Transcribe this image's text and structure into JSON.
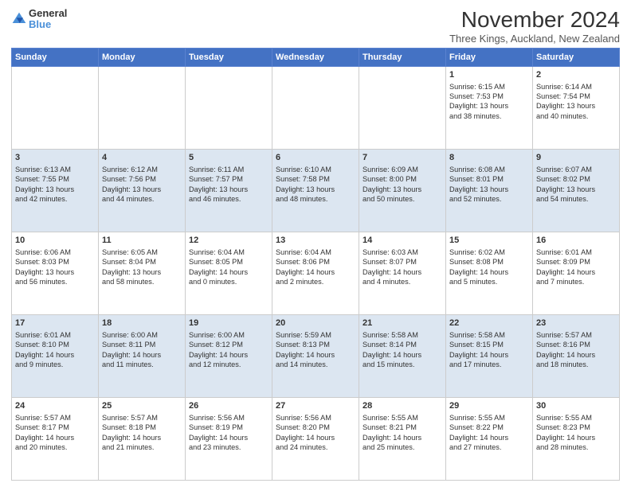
{
  "logo": {
    "general": "General",
    "blue": "Blue"
  },
  "title": "November 2024",
  "location": "Three Kings, Auckland, New Zealand",
  "days_header": [
    "Sunday",
    "Monday",
    "Tuesday",
    "Wednesday",
    "Thursday",
    "Friday",
    "Saturday"
  ],
  "weeks": [
    [
      {
        "day": "",
        "info": ""
      },
      {
        "day": "",
        "info": ""
      },
      {
        "day": "",
        "info": ""
      },
      {
        "day": "",
        "info": ""
      },
      {
        "day": "",
        "info": ""
      },
      {
        "day": "1",
        "info": "Sunrise: 6:15 AM\nSunset: 7:53 PM\nDaylight: 13 hours\nand 38 minutes."
      },
      {
        "day": "2",
        "info": "Sunrise: 6:14 AM\nSunset: 7:54 PM\nDaylight: 13 hours\nand 40 minutes."
      }
    ],
    [
      {
        "day": "3",
        "info": "Sunrise: 6:13 AM\nSunset: 7:55 PM\nDaylight: 13 hours\nand 42 minutes."
      },
      {
        "day": "4",
        "info": "Sunrise: 6:12 AM\nSunset: 7:56 PM\nDaylight: 13 hours\nand 44 minutes."
      },
      {
        "day": "5",
        "info": "Sunrise: 6:11 AM\nSunset: 7:57 PM\nDaylight: 13 hours\nand 46 minutes."
      },
      {
        "day": "6",
        "info": "Sunrise: 6:10 AM\nSunset: 7:58 PM\nDaylight: 13 hours\nand 48 minutes."
      },
      {
        "day": "7",
        "info": "Sunrise: 6:09 AM\nSunset: 8:00 PM\nDaylight: 13 hours\nand 50 minutes."
      },
      {
        "day": "8",
        "info": "Sunrise: 6:08 AM\nSunset: 8:01 PM\nDaylight: 13 hours\nand 52 minutes."
      },
      {
        "day": "9",
        "info": "Sunrise: 6:07 AM\nSunset: 8:02 PM\nDaylight: 13 hours\nand 54 minutes."
      }
    ],
    [
      {
        "day": "10",
        "info": "Sunrise: 6:06 AM\nSunset: 8:03 PM\nDaylight: 13 hours\nand 56 minutes."
      },
      {
        "day": "11",
        "info": "Sunrise: 6:05 AM\nSunset: 8:04 PM\nDaylight: 13 hours\nand 58 minutes."
      },
      {
        "day": "12",
        "info": "Sunrise: 6:04 AM\nSunset: 8:05 PM\nDaylight: 14 hours\nand 0 minutes."
      },
      {
        "day": "13",
        "info": "Sunrise: 6:04 AM\nSunset: 8:06 PM\nDaylight: 14 hours\nand 2 minutes."
      },
      {
        "day": "14",
        "info": "Sunrise: 6:03 AM\nSunset: 8:07 PM\nDaylight: 14 hours\nand 4 minutes."
      },
      {
        "day": "15",
        "info": "Sunrise: 6:02 AM\nSunset: 8:08 PM\nDaylight: 14 hours\nand 5 minutes."
      },
      {
        "day": "16",
        "info": "Sunrise: 6:01 AM\nSunset: 8:09 PM\nDaylight: 14 hours\nand 7 minutes."
      }
    ],
    [
      {
        "day": "17",
        "info": "Sunrise: 6:01 AM\nSunset: 8:10 PM\nDaylight: 14 hours\nand 9 minutes."
      },
      {
        "day": "18",
        "info": "Sunrise: 6:00 AM\nSunset: 8:11 PM\nDaylight: 14 hours\nand 11 minutes."
      },
      {
        "day": "19",
        "info": "Sunrise: 6:00 AM\nSunset: 8:12 PM\nDaylight: 14 hours\nand 12 minutes."
      },
      {
        "day": "20",
        "info": "Sunrise: 5:59 AM\nSunset: 8:13 PM\nDaylight: 14 hours\nand 14 minutes."
      },
      {
        "day": "21",
        "info": "Sunrise: 5:58 AM\nSunset: 8:14 PM\nDaylight: 14 hours\nand 15 minutes."
      },
      {
        "day": "22",
        "info": "Sunrise: 5:58 AM\nSunset: 8:15 PM\nDaylight: 14 hours\nand 17 minutes."
      },
      {
        "day": "23",
        "info": "Sunrise: 5:57 AM\nSunset: 8:16 PM\nDaylight: 14 hours\nand 18 minutes."
      }
    ],
    [
      {
        "day": "24",
        "info": "Sunrise: 5:57 AM\nSunset: 8:17 PM\nDaylight: 14 hours\nand 20 minutes."
      },
      {
        "day": "25",
        "info": "Sunrise: 5:57 AM\nSunset: 8:18 PM\nDaylight: 14 hours\nand 21 minutes."
      },
      {
        "day": "26",
        "info": "Sunrise: 5:56 AM\nSunset: 8:19 PM\nDaylight: 14 hours\nand 23 minutes."
      },
      {
        "day": "27",
        "info": "Sunrise: 5:56 AM\nSunset: 8:20 PM\nDaylight: 14 hours\nand 24 minutes."
      },
      {
        "day": "28",
        "info": "Sunrise: 5:55 AM\nSunset: 8:21 PM\nDaylight: 14 hours\nand 25 minutes."
      },
      {
        "day": "29",
        "info": "Sunrise: 5:55 AM\nSunset: 8:22 PM\nDaylight: 14 hours\nand 27 minutes."
      },
      {
        "day": "30",
        "info": "Sunrise: 5:55 AM\nSunset: 8:23 PM\nDaylight: 14 hours\nand 28 minutes."
      }
    ]
  ]
}
